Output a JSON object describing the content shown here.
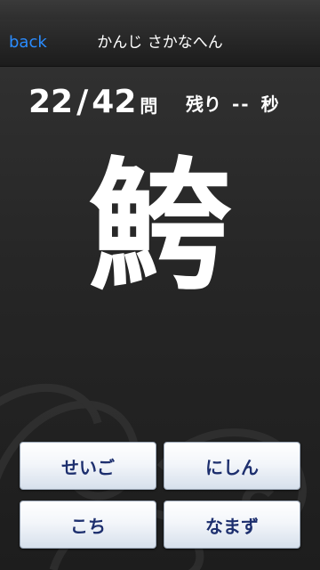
{
  "nav": {
    "back_label": "back",
    "title": "かんじ さかなへん"
  },
  "quiz": {
    "current": "22",
    "separator": "/",
    "total": "42",
    "unit": "問",
    "remaining_label": "残り",
    "remaining_value": "--",
    "seconds_unit": "秒",
    "kanji": "鮬"
  },
  "answers": [
    "せいご",
    "にしん",
    "こち",
    "なまず"
  ],
  "colors": {
    "link": "#2a8cff",
    "answer_text": "#1d2f6e",
    "background": "#262626"
  }
}
